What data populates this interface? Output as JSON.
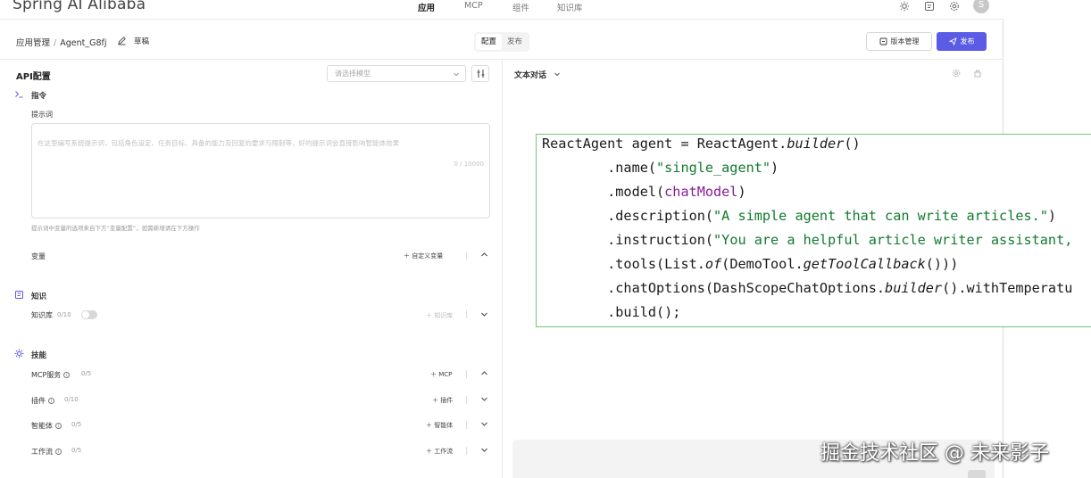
{
  "topnav": {
    "brand": "Spring AI Alibaba",
    "tabs": [
      {
        "label": "应用",
        "active": true
      },
      {
        "label": "MCP",
        "active": false
      },
      {
        "label": "组件",
        "active": false
      },
      {
        "label": "知识库",
        "active": false
      }
    ],
    "icons": [
      "sun-icon",
      "docs-icon",
      "settings-icon"
    ],
    "avatar": "S"
  },
  "subheader": {
    "breadcrumb_root": "应用管理",
    "breadcrumb_sep": "/",
    "breadcrumb_current": "Agent_G8fj",
    "draft_label": "草稿",
    "segment": [
      {
        "label": "配置",
        "active": true
      },
      {
        "label": "发布",
        "active": false
      }
    ],
    "version_button": "版本管理",
    "publish_button": "发布",
    "accent_color": "#5b5ce6"
  },
  "left": {
    "title": "API配置",
    "model_placeholder": "请选择模型",
    "instruction": {
      "title": "指令",
      "prompt_label": "提示词",
      "prompt_placeholder": "在这里编写系统提示词，包括角色设定、任务目标、具备的能力及回复的要求与限制等，好的提示词会直接影响智能体效果",
      "prompt_count": "0 / 10000",
      "hint": "提示词中变量的选项来自下方“变量配置”，如需新增请在下方操作",
      "variables_label": "变量",
      "custom_variable": "自定义变量"
    },
    "knowledge": {
      "title": "知识",
      "kb_label": "知识库",
      "kb_count": "0/10",
      "kb_action": "知识库"
    },
    "skills": {
      "title": "技能",
      "rows": [
        {
          "label": "MCP服务",
          "count": "0/5",
          "action": "MCP"
        },
        {
          "label": "插件",
          "count": "0/10",
          "action": "插件"
        },
        {
          "label": "智能体",
          "count": "0/5",
          "action": "智能体"
        },
        {
          "label": "工作流",
          "count": "0/5",
          "action": "工作流"
        }
      ]
    }
  },
  "right": {
    "title": "文本对话"
  },
  "code": {
    "lines": [
      "ReactAgent agent = ReactAgent.builder()",
      "        .name(\"single_agent\")",
      "        .model(chatModel)",
      "        .description(\"A simple agent that can write articles.\")",
      "        .instruction(\"You are a helpful article writer assistant,",
      "        .tools(List.of(DemoTool.getToolCallback()))",
      "        .chatOptions(DashScopeChatOptions.builder().withTemperatu",
      "        .build();"
    ]
  },
  "watermark": "掘金技术社区 @ 未来影子"
}
